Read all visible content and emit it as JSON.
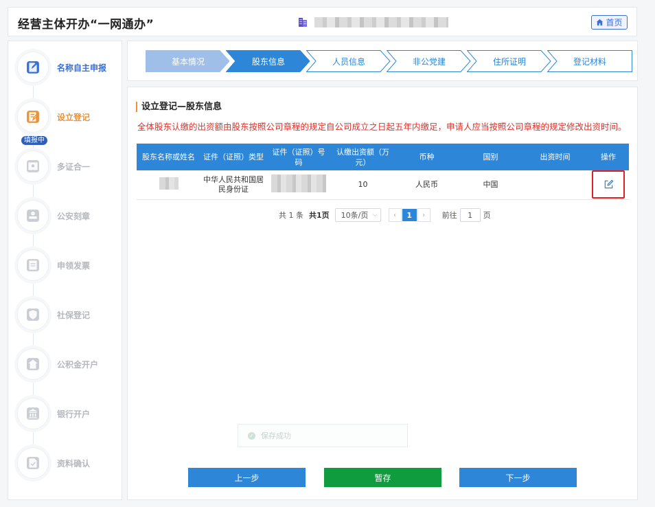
{
  "header": {
    "title": "经营主体开办“一网通办”",
    "home_label": "首页"
  },
  "sidebar": {
    "filling_badge": "填报中",
    "items": [
      {
        "label": "名称自主申报",
        "state": "done",
        "icon": "edit-doc-icon"
      },
      {
        "label": "设立登记",
        "state": "active",
        "icon": "form-edit-icon"
      },
      {
        "label": "多证合一",
        "state": "pending",
        "icon": "certificate-icon"
      },
      {
        "label": "公安刻章",
        "state": "pending",
        "icon": "stamp-icon"
      },
      {
        "label": "申领发票",
        "state": "pending",
        "icon": "invoice-icon"
      },
      {
        "label": "社保登记",
        "state": "pending",
        "icon": "shield-icon"
      },
      {
        "label": "公积金开户",
        "state": "pending",
        "icon": "house-yen-icon"
      },
      {
        "label": "银行开户",
        "state": "pending",
        "icon": "bank-icon"
      },
      {
        "label": "资料确认",
        "state": "pending",
        "icon": "file-check-icon"
      }
    ]
  },
  "progress": {
    "steps": [
      {
        "label": "基本情况",
        "state": "done"
      },
      {
        "label": "股东信息",
        "state": "current"
      },
      {
        "label": "人员信息",
        "state": "todo"
      },
      {
        "label": "非公党建",
        "state": "todo"
      },
      {
        "label": "住所证明",
        "state": "todo"
      },
      {
        "label": "登记材料",
        "state": "todo"
      }
    ]
  },
  "main": {
    "section_title": "设立登记—股东信息",
    "notice": "全体股东认缴的出资额由股东按照公司章程的规定自公司成立之日起五年内缴足，申请人应当按照公司章程的规定修改出资时间。",
    "table": {
      "headers": [
        "股东名称或姓名",
        "证件（证照）类型",
        "证件（证照）号码",
        "认缴出资额（万元）",
        "币种",
        "国别",
        "出资时间",
        "操作"
      ],
      "rows": [
        {
          "name": "",
          "id_type": "中华人民共和国居民身份证",
          "id_number": "",
          "amount": "10",
          "currency": "人民币",
          "country": "中国",
          "time": ""
        }
      ]
    },
    "pager": {
      "total_text": "共 1 条",
      "pages_text": "共1页",
      "page_size": "10条/页",
      "current_page": "1",
      "goto_label": "前往",
      "goto_value": "1",
      "page_suffix": "页"
    },
    "toast": "保存成功",
    "buttons": {
      "prev": "上一步",
      "save": "暂存",
      "next": "下一步"
    }
  },
  "colors": {
    "primary": "#2d86d8",
    "done_step": "#9fbfe8",
    "active": "#e8923a",
    "save": "#0f9c3e",
    "notice": "#e0302a",
    "highlight": "#e02020"
  }
}
